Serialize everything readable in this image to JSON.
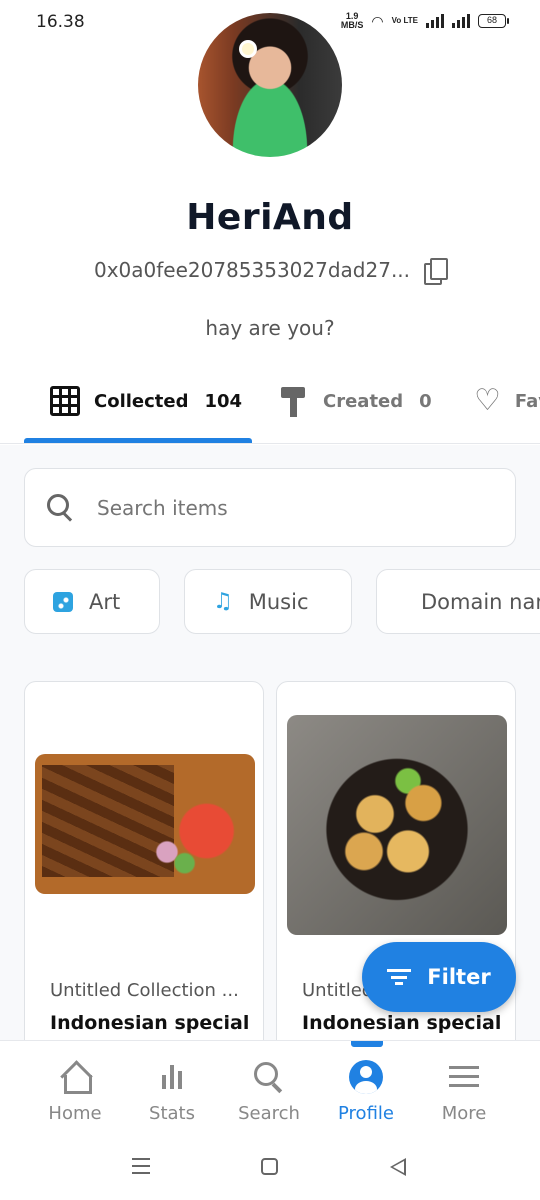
{
  "status_bar": {
    "time": "16.38",
    "speed_value": "1.9",
    "speed_unit": "MB/S",
    "volte": "Vo LTE",
    "battery": "68"
  },
  "profile": {
    "username": "HeriAnd",
    "address": "0x0a0fee20785353027dad27...",
    "bio": "hay are you?"
  },
  "tabs": [
    {
      "label": "Collected",
      "count": "104",
      "icon": "grid-icon"
    },
    {
      "label": "Created",
      "count": "0",
      "icon": "paint-roller-icon"
    },
    {
      "label": "Favorited",
      "icon": "heart-icon"
    }
  ],
  "search": {
    "placeholder": "Search items"
  },
  "categories": [
    {
      "label": "Art",
      "icon": "art-icon"
    },
    {
      "label": "Music",
      "icon": "music-icon"
    },
    {
      "label": "Domain names",
      "icon": "domain-icon"
    }
  ],
  "items": [
    {
      "collection": "Untitled Collection ...",
      "name": "Indonesian special"
    },
    {
      "collection": "Untitled Collection ...",
      "name": "Indonesian special"
    }
  ],
  "filter_button": {
    "label": "Filter",
    "icon": "filter-icon"
  },
  "bottom_nav": [
    {
      "label": "Home",
      "icon": "home-icon"
    },
    {
      "label": "Stats",
      "icon": "stats-icon"
    },
    {
      "label": "Search",
      "icon": "search-icon"
    },
    {
      "label": "Profile",
      "icon": "profile-icon",
      "active": true
    },
    {
      "label": "More",
      "icon": "menu-icon"
    }
  ],
  "colors": {
    "accent": "#2081e2",
    "category_icon": "#2ea3e0",
    "text_primary": "#101828",
    "text_secondary": "#555555"
  }
}
